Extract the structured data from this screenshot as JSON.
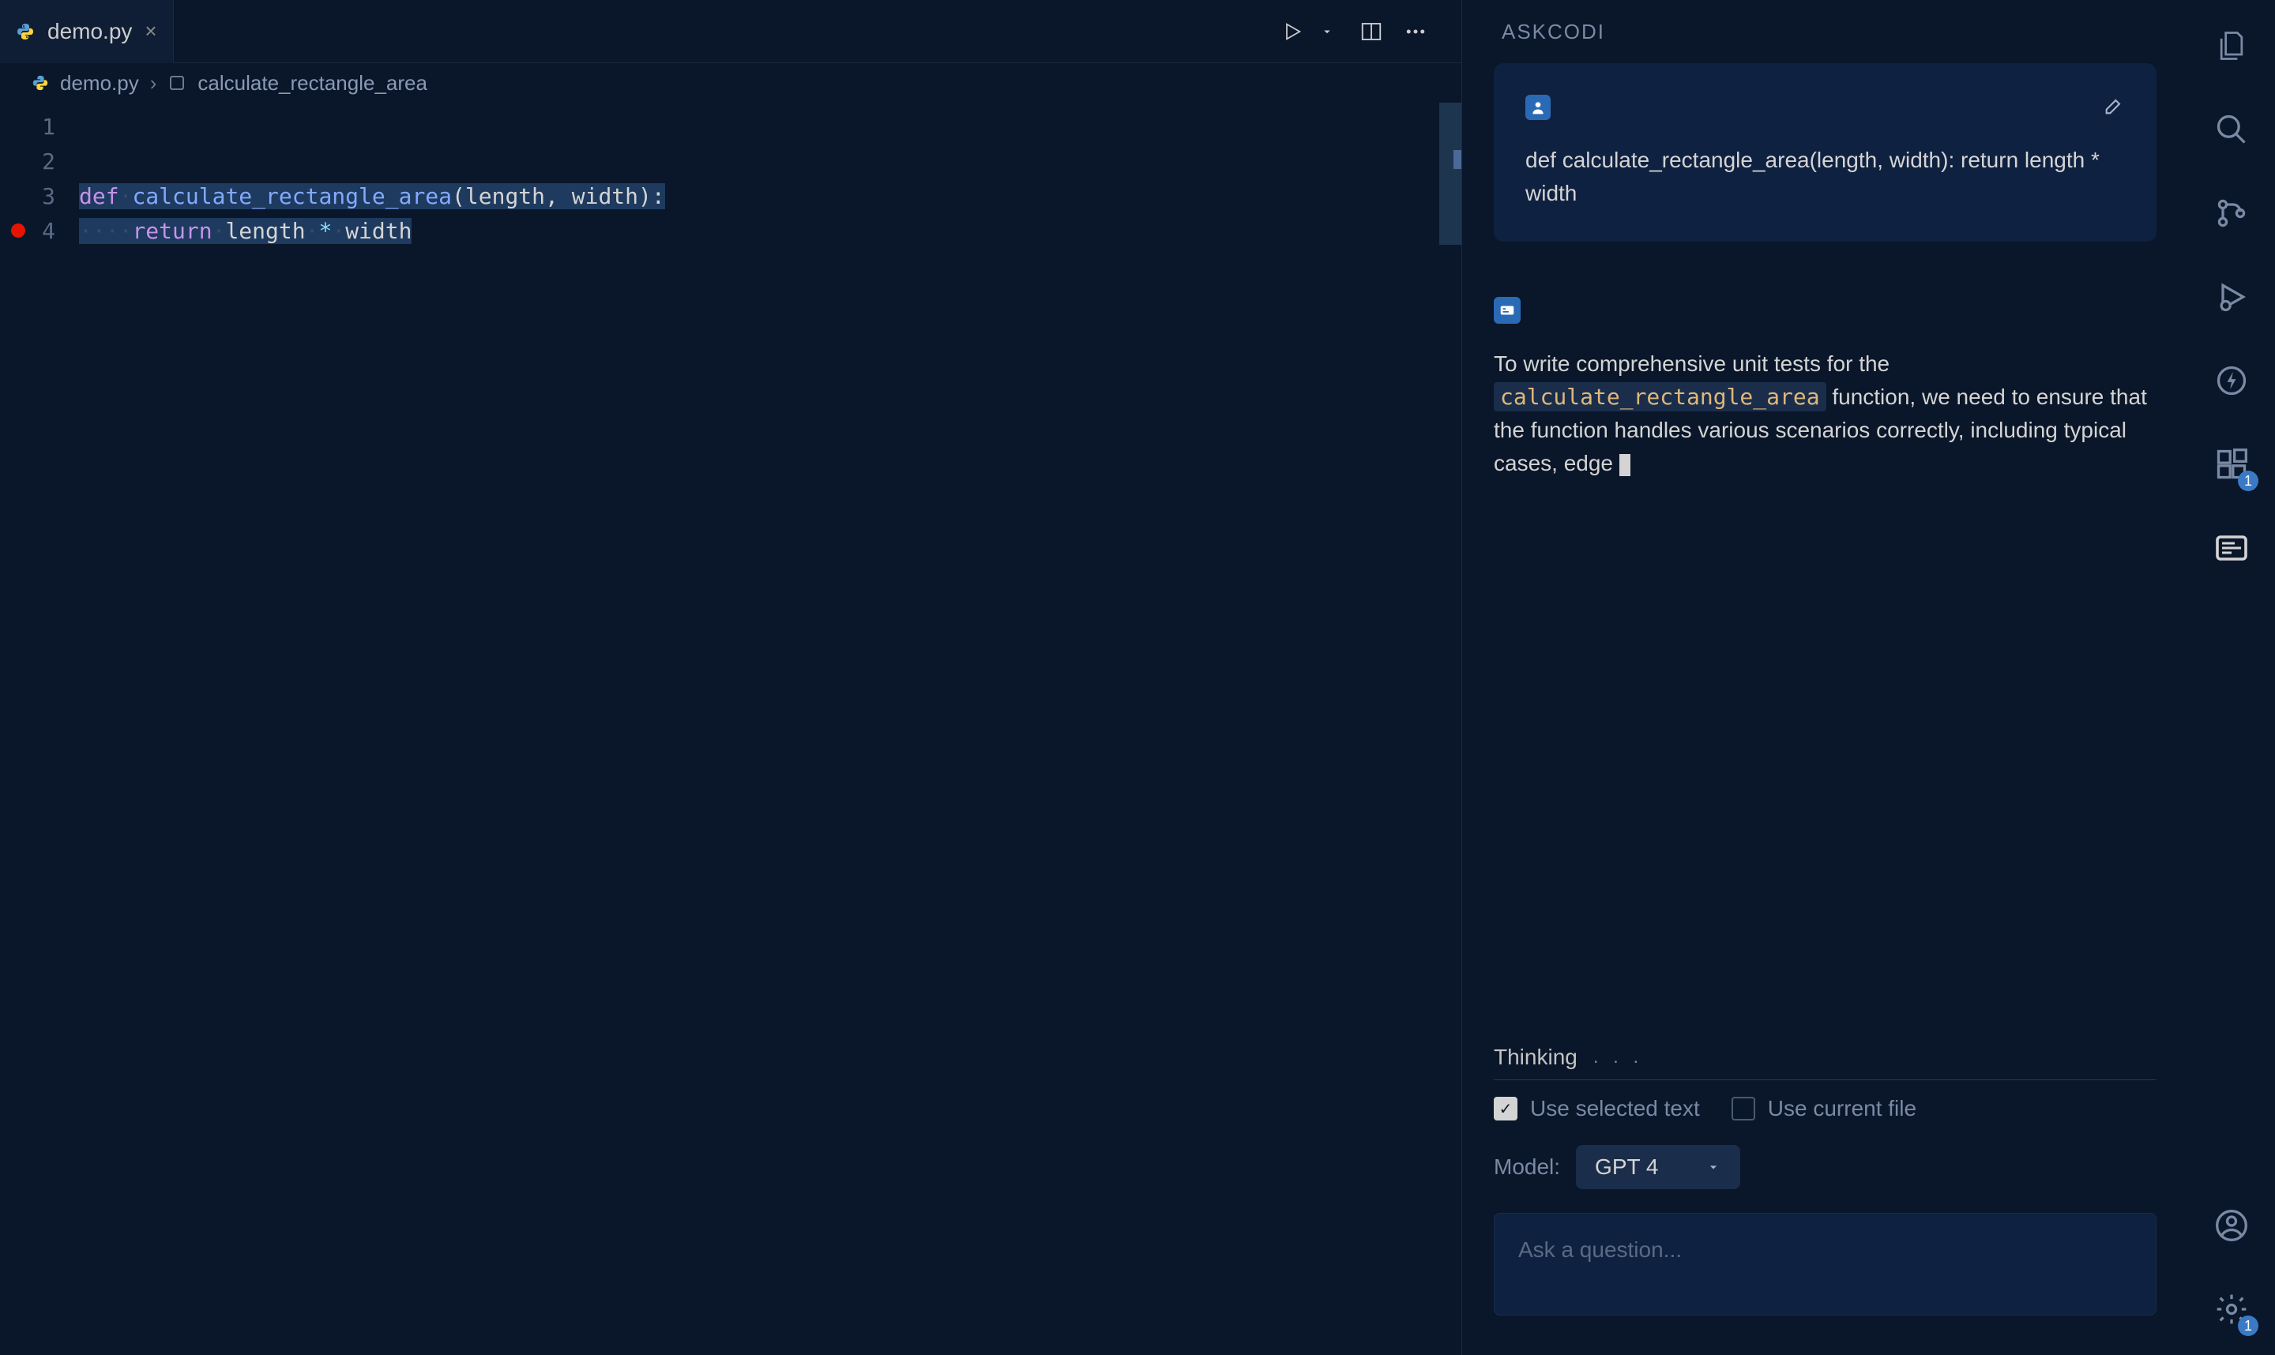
{
  "tab": {
    "filename": "demo.py"
  },
  "breadcrumb": {
    "file": "demo.py",
    "symbol": "calculate_rectangle_area"
  },
  "editor": {
    "lines": [
      "1",
      "2",
      "3",
      "4"
    ],
    "line3": {
      "def": "def",
      "fn": "calculate_rectangle_area",
      "params": "(length, width)",
      "colon": ":"
    },
    "line4": {
      "return": "return",
      "expr_a": "length",
      "op": "*",
      "expr_b": "width"
    }
  },
  "panel": {
    "title": "ASKCODI",
    "user_msg": "def calculate_rectangle_area(length, width): return length * width",
    "ai_pre": "To write comprehensive unit tests for the ",
    "ai_code": "calculate_rectangle_area",
    "ai_post": " function, we need to ensure that the function handles various scenarios correctly, including typical cases, edge ",
    "thinking": "Thinking",
    "opt_selected": "Use selected text",
    "opt_file": "Use current file",
    "model_label": "Model:",
    "model_value": "GPT 4",
    "input_placeholder": "Ask a question..."
  },
  "badges": {
    "extensions": "1",
    "settings": "1"
  }
}
